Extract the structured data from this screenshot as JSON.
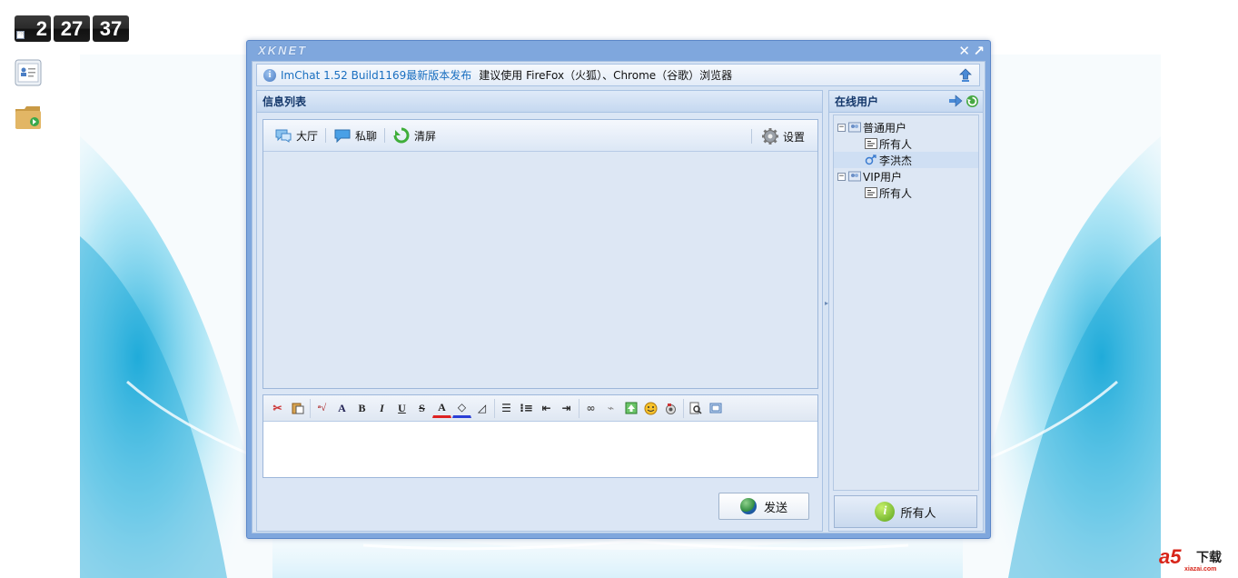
{
  "clock": {
    "hours": "2",
    "minutes": "27",
    "seconds": "37",
    "meridiem": "PM"
  },
  "desktop": {
    "icons": [
      "contact-card-icon",
      "folder-add-icon"
    ]
  },
  "window": {
    "title": "XKNET",
    "notice": {
      "link": "ImChat 1.52 Build1169最新版本发布",
      "text": "建议使用 FireFox（火狐）、Chrome（谷歌）浏览器"
    },
    "message_panel": {
      "title": "信息列表",
      "toolbar": {
        "hall": "大厅",
        "private": "私聊",
        "clear": "清屏",
        "settings": "设置"
      },
      "send_label": "发送"
    },
    "users_panel": {
      "title": "在线用户",
      "groups": [
        {
          "name": "普通用户",
          "members": [
            "所有人",
            "李洪杰"
          ]
        },
        {
          "name": "VIP用户",
          "members": [
            "所有人"
          ]
        }
      ],
      "target_label": "所有人"
    }
  },
  "watermark": {
    "brand": "a5",
    "text": "下载",
    "url": "xiazai.com"
  }
}
